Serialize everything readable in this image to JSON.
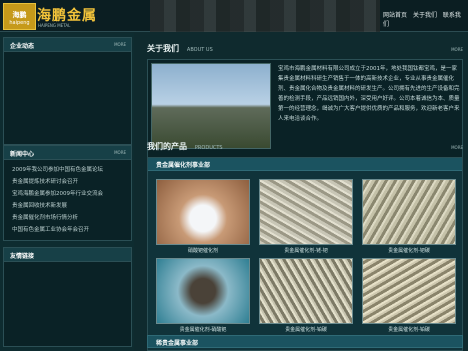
{
  "header": {
    "logo_badge_top": "海鹏",
    "logo_badge_sub": "haipeng",
    "company_name": "海鹏金属",
    "company_en": "HAIPENG METAL",
    "nav": [
      "网站首页",
      "关于我们",
      "联系我们"
    ]
  },
  "sidebar": {
    "corp_news_title": "企业动态",
    "corp_news_more": "MORE",
    "news_center_title": "新闻中心",
    "news_center_more": "MORE",
    "news_items": [
      "2009年我公司参加中国有色金属论坛",
      "贵金属提炼技术研讨会召开",
      "宝鸡海鹏金属参加2009年行业交流会",
      "贵金属回收技术新发展",
      "贵金属催化剂市场行情分析",
      "中国有色金属工业协会年会召开"
    ],
    "links_title": "友情链接"
  },
  "about": {
    "title_cn": "关于我们",
    "title_en": "ABOUT US",
    "more": "MORE",
    "text": "宝鸡市海鹏金属材料有限公司成立于2001年，地处我国钛都宝鸡，是一家集贵金属材料科研生产销售于一体的高新技术企业，专业从事贵金属催化剂、贵金属化合物及贵金属材料的研发生产。公司拥有先进的生产设备和完善的检测手段，产品远销国内外，深受用户好评。公司本着诚信为本、质量第一的经营理念，竭诚为广大客户提供优质的产品和服务，欢迎新老客户来人来电洽谈合作。"
  },
  "products": {
    "title_cn": "我们的产品",
    "title_en": "PRODUCTS",
    "more": "MORE",
    "section1": "贵金属催化剂事业部",
    "items": [
      {
        "caption": "硝酸钯催化剂"
      },
      {
        "caption": "贵金属催化剂-铑-钯"
      },
      {
        "caption": "贵金属催化剂-钯碳"
      },
      {
        "caption": "贵金属催化剂-硝酸钯"
      },
      {
        "caption": "贵金属催化剂-铂碳"
      },
      {
        "caption": "贵金属催化剂-铂碳"
      }
    ],
    "section2": "稀贵金属事业部"
  }
}
